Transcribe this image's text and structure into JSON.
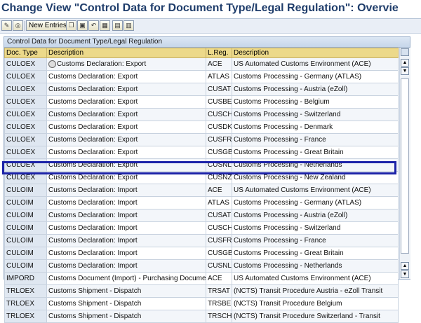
{
  "title": "Change View \"Control Data for Document Type/Legal Regulation\": Overvie",
  "toolbar": {
    "new_entries_label": "New Entries"
  },
  "table": {
    "caption": "Control Data for Document Type/Legal Regulation",
    "headers": [
      "Doc. Type",
      "Description",
      "L.Reg.",
      "Description"
    ],
    "rows": [
      [
        "CULOEX",
        "Customs Declaration: Export",
        "ACE",
        "US Automated Customs Environment (ACE)"
      ],
      [
        "CULOEX",
        "Customs Declaration: Export",
        "ATLAS",
        "Customs Processing - Germany (ATLAS)"
      ],
      [
        "CULOEX",
        "Customs Declaration: Export",
        "CUSAT",
        "Customs Processing - Austria (eZoll)"
      ],
      [
        "CULOEX",
        "Customs Declaration: Export",
        "CUSBE",
        "Customs Processing - Belgium"
      ],
      [
        "CULOEX",
        "Customs Declaration: Export",
        "CUSCH",
        "Customs Processing - Switzerland"
      ],
      [
        "CULOEX",
        "Customs Declaration: Export",
        "CUSDK",
        "Customs Processing - Denmark"
      ],
      [
        "CULOEX",
        "Customs Declaration: Export",
        "CUSFR",
        "Customs Processing - France"
      ],
      [
        "CULOEX",
        "Customs Declaration: Export",
        "CUSGB",
        "Customs Processing - Great Britain"
      ],
      [
        "CULOEX",
        "Customs Declaration: Export",
        "CUSNL",
        "Customs Processing - Netherlands"
      ],
      [
        "CULOEX",
        "Customs Declaration: Export",
        "CUSNZ",
        "Customs Processing - New Zealand"
      ],
      [
        "CULOIM",
        "Customs Declaration: Import",
        "ACE",
        "US Automated Customs Environment (ACE)"
      ],
      [
        "CULOIM",
        "Customs Declaration: Import",
        "ATLAS",
        "Customs Processing - Germany (ATLAS)"
      ],
      [
        "CULOIM",
        "Customs Declaration: Import",
        "CUSAT",
        "Customs Processing - Austria (eZoll)"
      ],
      [
        "CULOIM",
        "Customs Declaration: Import",
        "CUSCH",
        "Customs Processing - Switzerland"
      ],
      [
        "CULOIM",
        "Customs Declaration: Import",
        "CUSFR",
        "Customs Processing - France"
      ],
      [
        "CULOIM",
        "Customs Declaration: Import",
        "CUSGB",
        "Customs Processing - Great Britain"
      ],
      [
        "CULOIM",
        "Customs Declaration: Import",
        "CUSNL",
        "Customs Processing - Netherlands"
      ],
      [
        "IMPORD",
        "Customs Document (Import) - Purchasing Document Lev",
        "ACE",
        "US Automated Customs Environment (ACE)"
      ],
      [
        "TRLOEX",
        "Customs Shipment - Dispatch",
        "TRSAT",
        "(NCTS) Transit Procedure Austria - eZoll Transit"
      ],
      [
        "TRLOEX",
        "Customs Shipment - Dispatch",
        "TRSBE",
        "(NCTS) Transit Procedure Belgium"
      ],
      [
        "TRLOEX",
        "Customs Shipment - Dispatch",
        "TRSCH",
        "(NCTS) Transit Procedure Switzerland - Transit"
      ]
    ],
    "highlighted_row": 10
  },
  "colors": {
    "title": "#1f3d6b",
    "header_bg": "#ecd98a",
    "highlight_border": "#1c23a8"
  },
  "icons": [
    "edit-icon",
    "glasses-display-icon",
    "copy-icon",
    "delete-icon",
    "undo-icon",
    "select-all-icon",
    "select-block-icon",
    "deselect-all-icon",
    "table-config-icon",
    "scroll-up-icon",
    "scroll-down-icon"
  ]
}
